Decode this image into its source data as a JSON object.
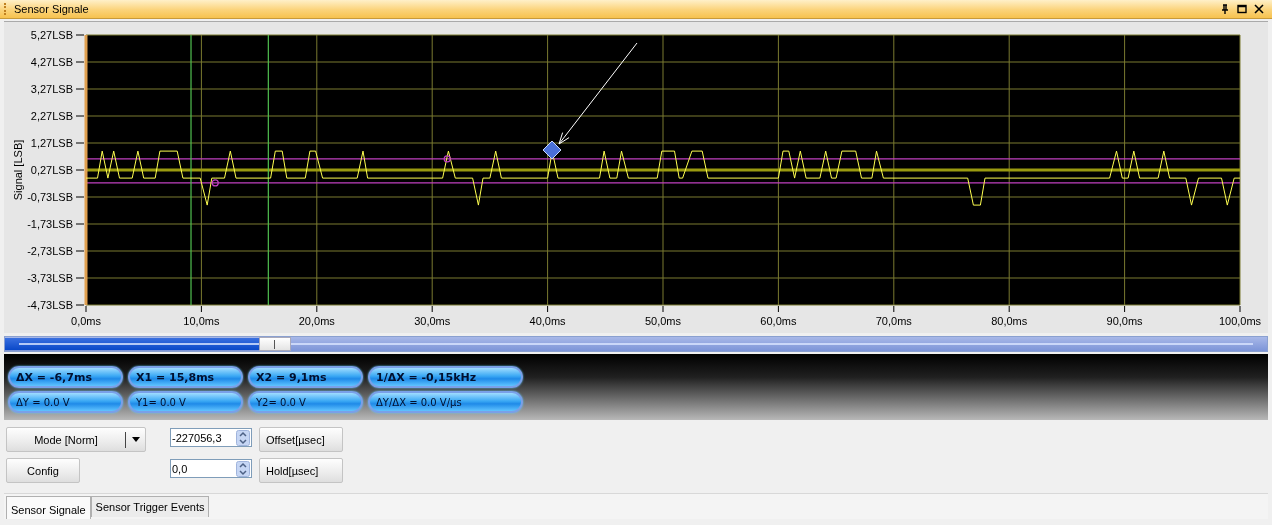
{
  "window": {
    "title": "Sensor Signale"
  },
  "chart": {
    "chart_data": {
      "type": "line",
      "ylabel": "Signal [LSB]",
      "x": [
        0.0,
        1.0,
        1.4,
        1.9,
        2.4,
        2.9,
        4.0,
        4.5,
        5.0,
        6.0,
        6.4,
        7.9,
        8.4,
        9.9,
        10.5,
        10.9,
        11.2,
        12.0,
        12.5,
        13.0,
        16.0,
        16.4,
        17.0,
        17.4,
        19.0,
        19.4,
        19.9,
        20.5,
        23.5,
        24.0,
        24.4,
        30.9,
        31.3,
        31.4,
        32.0,
        33.5,
        34.0,
        34.4,
        35.0,
        35.5,
        36.0,
        40.0,
        40.4,
        40.9,
        44.5,
        44.9,
        45.4,
        46.0,
        46.4,
        47.0,
        49.5,
        49.9,
        51.0,
        51.4,
        51.7,
        52.5,
        53.4,
        53.9,
        60.0,
        60.4,
        60.9,
        61.4,
        61.9,
        62.4,
        63.6,
        64.1,
        64.6,
        65.0,
        65.5,
        66.7,
        67.2,
        68.1,
        68.5,
        69.1,
        76.4,
        76.9,
        77.5,
        77.9,
        88.7,
        89.3,
        89.8,
        90.3,
        90.8,
        91.3,
        92.9,
        93.4,
        93.9,
        95.3,
        95.8,
        96.4,
        98.4,
        98.9,
        99.5,
        100.0
      ],
      "grid": true,
      "ref_lines": [
        {
          "axis": "y",
          "value": 0.27,
          "color": "#9a9a10"
        },
        {
          "axis": "y",
          "value": 0.68,
          "color": "#c040c0"
        },
        {
          "axis": "y",
          "value": -0.21,
          "color": "#c040c0"
        },
        {
          "axis": "x",
          "value": 9.1,
          "color": "#50c050"
        },
        {
          "axis": "x",
          "value": 15.8,
          "color": "#50c050"
        }
      ],
      "series": [
        {
          "color": "#ffff50",
          "values": [
            -0.03,
            -0.03,
            0.97,
            -0.03,
            0.97,
            -0.03,
            -0.03,
            0.97,
            -0.03,
            -0.03,
            0.97,
            0.97,
            -0.03,
            -0.03,
            -1.03,
            -0.03,
            -0.03,
            -0.03,
            0.97,
            -0.03,
            -0.03,
            0.97,
            0.97,
            -0.03,
            -0.03,
            0.97,
            0.97,
            -0.03,
            -0.03,
            0.97,
            -0.03,
            -0.03,
            0.77,
            0.97,
            -0.03,
            -0.03,
            -1.03,
            -0.03,
            -0.03,
            0.97,
            -0.03,
            -0.03,
            0.97,
            -0.03,
            -0.03,
            0.97,
            -0.03,
            -0.03,
            0.97,
            -0.03,
            -0.03,
            0.97,
            0.97,
            -0.03,
            -0.03,
            0.97,
            0.97,
            -0.03,
            -0.03,
            0.97,
            0.97,
            -0.03,
            0.97,
            -0.03,
            -0.03,
            0.97,
            -0.03,
            -0.03,
            0.97,
            0.97,
            -0.03,
            -0.03,
            0.97,
            -0.03,
            -0.03,
            -1.03,
            -1.03,
            -0.03,
            -0.03,
            0.97,
            -0.03,
            -0.03,
            0.97,
            -0.03,
            -0.03,
            0.97,
            -0.03,
            -0.03,
            -1.03,
            -0.03,
            -0.03,
            -1.03,
            -0.03,
            -0.03
          ]
        },
        {
          "color": "#c040c0",
          "marker": "o",
          "values": [
            null,
            null,
            null,
            null,
            null,
            null,
            null,
            null,
            null,
            null,
            null,
            null,
            null,
            null,
            null,
            null,
            -0.21,
            null,
            null,
            null,
            null,
            null,
            null,
            null,
            null,
            null,
            null,
            null,
            null,
            null,
            null,
            null,
            0.68,
            null,
            null,
            null,
            null,
            null,
            null,
            null,
            null,
            null,
            null,
            null,
            null,
            null,
            null,
            null,
            null,
            null,
            null,
            null,
            null,
            null,
            null,
            null,
            null,
            null,
            null,
            null,
            null,
            null,
            null,
            null,
            null,
            null,
            null,
            null,
            null,
            null,
            null,
            null,
            null,
            null,
            null,
            null,
            null,
            null,
            null,
            null,
            null,
            null,
            null,
            null,
            null,
            null,
            null,
            null,
            null,
            null,
            null,
            null,
            null,
            null
          ]
        }
      ],
      "xlim": [
        0,
        100
      ],
      "ylim": [
        -4.73,
        5.27
      ],
      "xticks": [
        {
          "value": 0,
          "label": "0,0ms"
        },
        {
          "value": 10,
          "label": "10,0ms"
        },
        {
          "value": 20,
          "label": "20,0ms"
        },
        {
          "value": 30,
          "label": "30,0ms"
        },
        {
          "value": 40,
          "label": "40,0ms"
        },
        {
          "value": 50,
          "label": "50,0ms"
        },
        {
          "value": 60,
          "label": "60,0ms"
        },
        {
          "value": 70,
          "label": "70,0ms"
        },
        {
          "value": 80,
          "label": "80,0ms"
        },
        {
          "value": 90,
          "label": "90,0ms"
        },
        {
          "value": 100,
          "label": "100,0ms"
        }
      ],
      "yticks": [
        {
          "value": 5.27,
          "label": "5,27LSB"
        },
        {
          "value": 4.27,
          "label": "4,27LSB"
        },
        {
          "value": 3.27,
          "label": "3,27LSB"
        },
        {
          "value": 2.27,
          "label": "2,27LSB"
        },
        {
          "value": 1.27,
          "label": "1,27LSB"
        },
        {
          "value": 0.27,
          "label": "0,27LSB"
        },
        {
          "value": -0.73,
          "label": "-0,73LSB"
        },
        {
          "value": -1.73,
          "label": "-1,73LSB"
        },
        {
          "value": -2.73,
          "label": "-2,73LSB"
        },
        {
          "value": -3.73,
          "label": "-3,73LSB"
        },
        {
          "value": -4.73,
          "label": "-4,73LSB"
        }
      ]
    }
  },
  "readouts": [
    {
      "text": "ΔX = -6,7ms",
      "kind": "primary"
    },
    {
      "text": "X1 = 15,8ms",
      "kind": "primary"
    },
    {
      "text": "X2 = 9,1ms",
      "kind": "primary"
    },
    {
      "text": "1/ΔX = -0,15kHz",
      "kind": "primary"
    },
    {
      "text": "ΔY = 0.0 V",
      "kind": "secondary"
    },
    {
      "text": "Y1= 0.0 V",
      "kind": "secondary"
    },
    {
      "text": "Y2= 0.0 V",
      "kind": "secondary"
    },
    {
      "text": "ΔY/ΔX = 0.0 V/µs",
      "kind": "secondary"
    }
  ],
  "controls": {
    "mode_button": "Mode [Norm]",
    "config_button": "Config",
    "offset": {
      "value": "-227056,3",
      "unit": "Offset[µsec]"
    },
    "hold": {
      "value": "0,0",
      "unit": "Hold[µsec]"
    }
  },
  "tabs": [
    {
      "label": "Sensor Signale",
      "selected": true
    },
    {
      "label": "Sensor Trigger Events",
      "selected": false
    }
  ]
}
